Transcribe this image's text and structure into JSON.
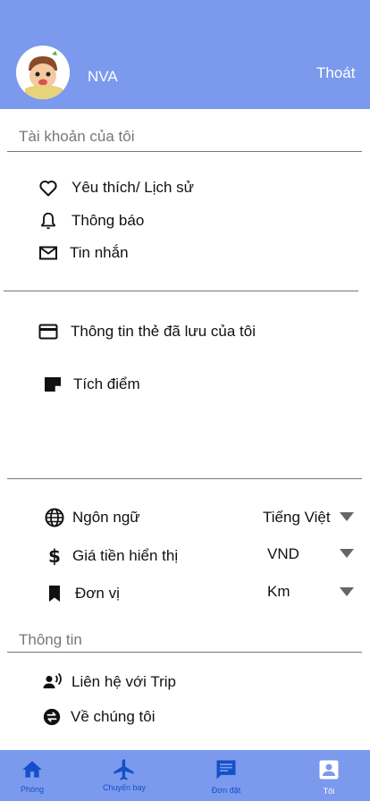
{
  "header": {
    "username": "NVA",
    "logout_label": "Thoát"
  },
  "account": {
    "title": "Tài khoản của tôi",
    "items": [
      {
        "label": "Yêu thích/ Lịch sử",
        "icon": "heart-icon"
      },
      {
        "label": "Thông báo",
        "icon": "bell-icon"
      },
      {
        "label": "Tin nhắn",
        "icon": "mail-icon"
      }
    ]
  },
  "wallet": {
    "items": [
      {
        "label": "Thông tin thẻ đã lưu của tôi",
        "icon": "credit-card-icon"
      },
      {
        "label": "Tích điểm",
        "icon": "note-icon"
      }
    ]
  },
  "settings": {
    "items": [
      {
        "label": "Ngôn ngữ",
        "value": "Tiếng Việt",
        "icon": "globe-icon"
      },
      {
        "label": "Giá tiền hiển thị",
        "value": "VND",
        "icon": "dollar-icon"
      },
      {
        "label": "Đơn vị",
        "value": "Km",
        "icon": "bookmark-icon"
      }
    ]
  },
  "info": {
    "title": "Thông tin",
    "items": [
      {
        "label": "Liên hệ với Trip",
        "icon": "contact-voice-icon"
      },
      {
        "label": "Về chúng tôi",
        "icon": "swap-circle-icon"
      }
    ]
  },
  "tabs": [
    {
      "label": "Phòng",
      "icon": "home-icon"
    },
    {
      "label": "Chuyến bay",
      "icon": "airplane-icon"
    },
    {
      "label": "Đơn đặt",
      "icon": "chat-icon"
    },
    {
      "label": "Tôi",
      "icon": "account-box-icon"
    }
  ],
  "colors": {
    "header": "#7b9aed",
    "tab_accent": "#1450c8",
    "tab_inactive": "#ffffff"
  }
}
